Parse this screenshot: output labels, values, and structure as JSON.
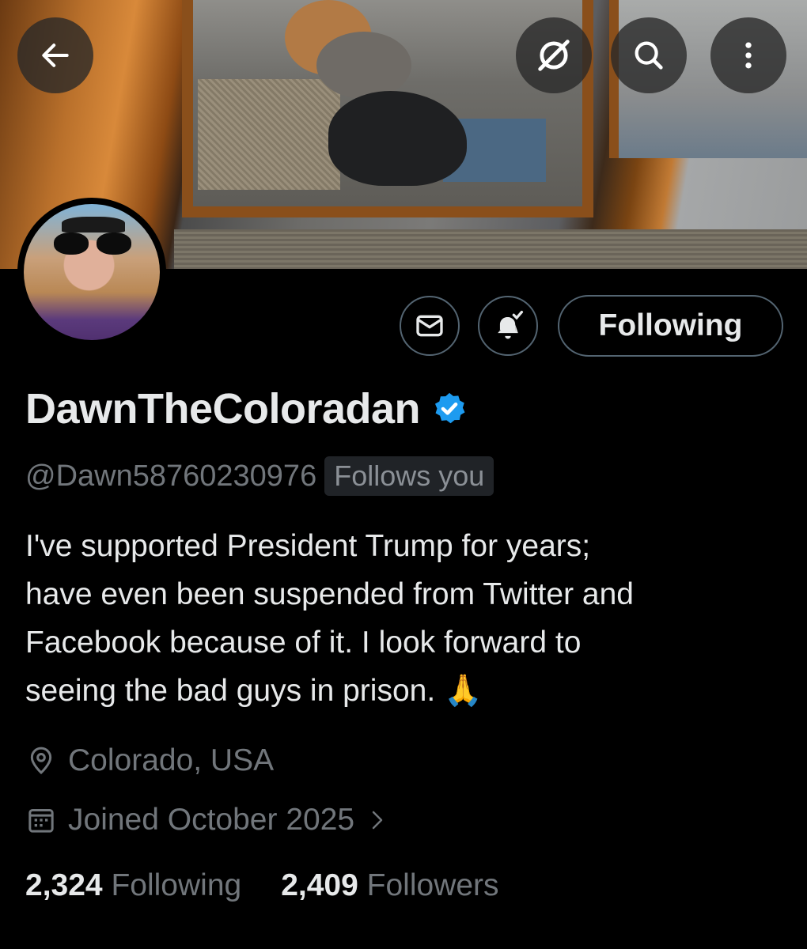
{
  "header": {
    "back_icon": "arrow-left-icon",
    "grok_icon": "grok-icon",
    "search_icon": "search-icon",
    "more_icon": "more-vertical-icon"
  },
  "profile": {
    "display_name": "DawnTheColoradan",
    "verified_badge": "verified-badge-icon",
    "handle": "@Dawn58760230976",
    "follows_you": "Follows you",
    "bio": "I've supported President Trump for years;\nhave even been suspended from Twitter and\nFacebook because of it.  I look forward to\nseeing the bad guys in prison. 🙏",
    "location": "Colorado, USA",
    "joined": "Joined October 2025",
    "following_count": "2,324",
    "following_label": "Following",
    "followers_count": "2,409",
    "followers_label": "Followers"
  },
  "actions": {
    "message_icon": "envelope-icon",
    "notifications_icon": "bell-check-icon",
    "follow_button": "Following"
  },
  "colors": {
    "background": "#000000",
    "primary_text": "#e7e9ea",
    "secondary_text": "#71767b",
    "verified_blue": "#1d9bf0",
    "button_border": "#536471"
  }
}
